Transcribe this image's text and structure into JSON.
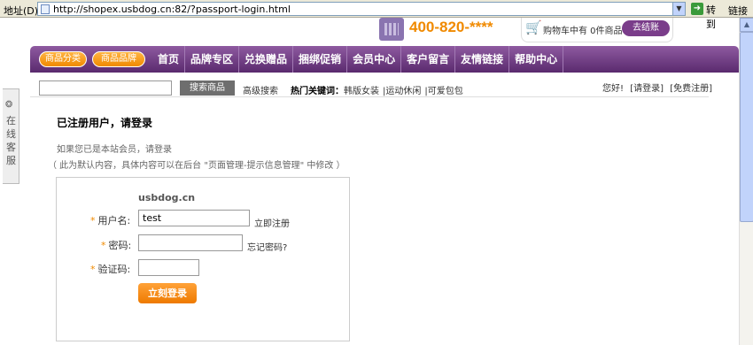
{
  "browser": {
    "address_label": "地址(D)",
    "url": "http://shopex.usbdog.cn:82/?passport-login.html",
    "go_label": "转到",
    "links_label": "链接"
  },
  "header": {
    "hotline": "400-820-****",
    "cart_text": "购物车中有 0件商品",
    "checkout_label": "去结账"
  },
  "nav": {
    "category_buttons": [
      "商品分类",
      "商品品牌"
    ],
    "items": [
      "首页",
      "品牌专区",
      "兑换赠品",
      "捆绑促销",
      "会员中心",
      "客户留言",
      "友情链接",
      "帮助中心"
    ]
  },
  "search": {
    "placeholder": "",
    "button": "搜索商品",
    "advanced": "高级搜索",
    "hot_label": "热门关键词：",
    "hot_links": [
      "韩版女装",
      "|运动休闲",
      "|可爱包包"
    ]
  },
  "user_links": [
    "您好!",
    "[请登录]",
    "[免费注册]"
  ],
  "sidebar": {
    "online_service": "在线客服"
  },
  "main": {
    "title": "已注册用户，请登录",
    "info1": "如果您已是本站会员，请登录",
    "info2": "（ 此为默认内容，具体内容可以在后台 \"页面管理-提示信息管理\" 中修改 ）",
    "site_name": "usbdog.cn",
    "username_label": "用户名:",
    "username_value": "test",
    "register_link": "立即注册",
    "password_label": "密码:",
    "forgot_link": "忘记密码?",
    "captcha_label": "验证码:",
    "login_button": "立刻登录",
    "required_mark": "*"
  },
  "colors": {
    "brand_purple": "#6e3a82",
    "accent_orange": "#f08a00"
  }
}
